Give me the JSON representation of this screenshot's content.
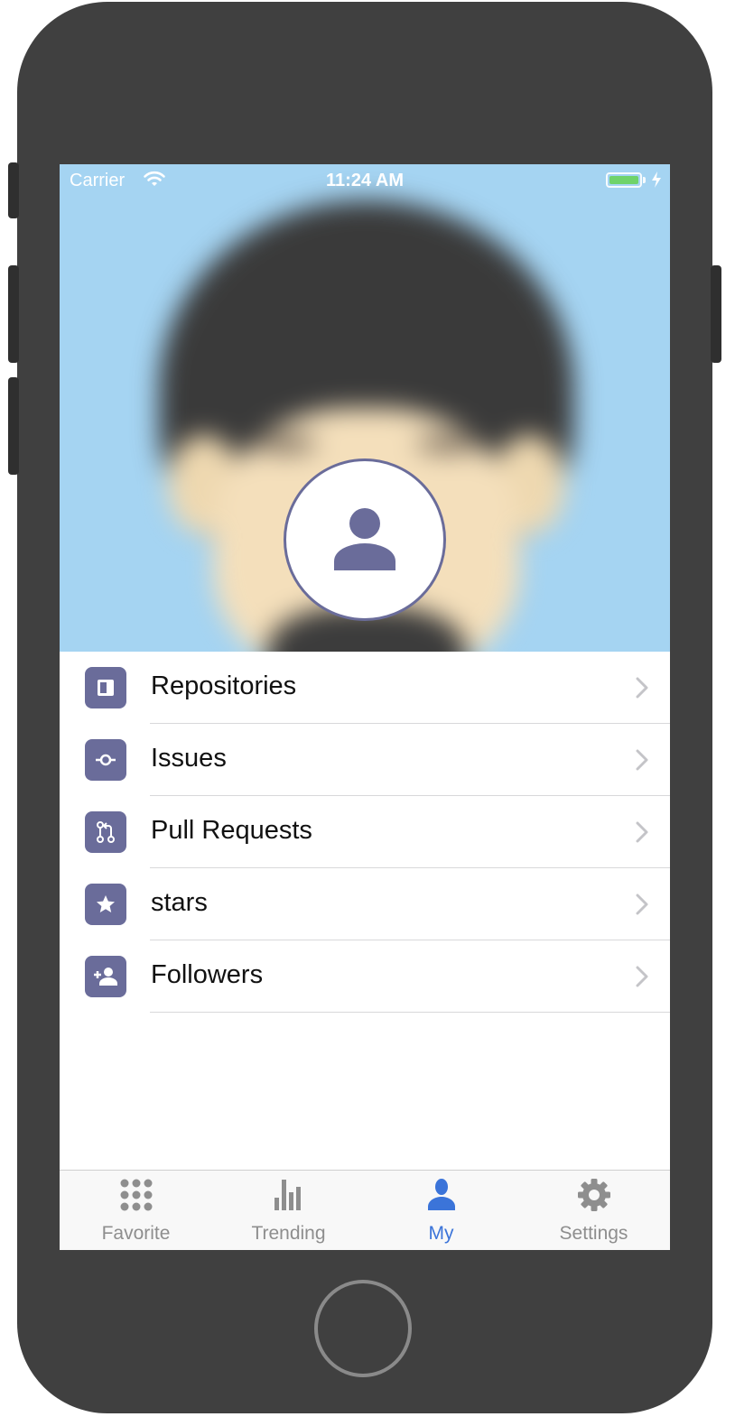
{
  "status_bar": {
    "carrier": "Carrier",
    "time": "11:24 AM"
  },
  "menu": {
    "items": [
      {
        "label": "Repositories",
        "icon": "repository-icon"
      },
      {
        "label": "Issues",
        "icon": "issue-icon"
      },
      {
        "label": "Pull Requests",
        "icon": "pull-request-icon"
      },
      {
        "label": "stars",
        "icon": "star-icon"
      },
      {
        "label": "Followers",
        "icon": "add-person-icon"
      }
    ]
  },
  "tab_bar": {
    "tabs": [
      {
        "label": "Favorite",
        "icon": "grid-icon",
        "active": false
      },
      {
        "label": "Trending",
        "icon": "bar-chart-icon",
        "active": false
      },
      {
        "label": "My",
        "icon": "person-icon",
        "active": true
      },
      {
        "label": "Settings",
        "icon": "gear-icon",
        "active": false
      }
    ]
  },
  "colors": {
    "accent": "#6a6c9a",
    "tab_active": "#3b74d9",
    "tab_inactive": "#8e8e8e",
    "header_bg": "#a5d4f2"
  }
}
